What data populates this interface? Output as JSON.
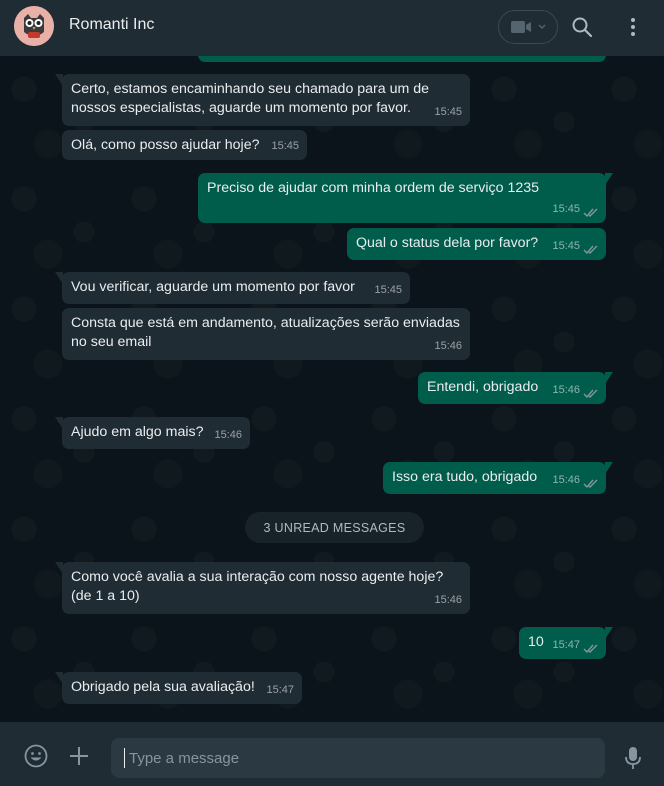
{
  "header": {
    "contact_name": "Romanti Inc",
    "avatar": "owl-logo",
    "icons": [
      "video-call-icon",
      "chevron-down-icon",
      "search-icon",
      "menu-dots-icon"
    ]
  },
  "messages": [
    {
      "dir": "in",
      "text": "Certo, estamos encaminhando seu chamado para um de nossos especialistas, aguarde um momento por favor.",
      "time": "15:45"
    },
    {
      "dir": "in",
      "text": "Olá, como posso ajudar hoje?",
      "time": "15:45"
    },
    {
      "dir": "out",
      "text": "Preciso de ajudar com minha ordem de serviço 1235",
      "time": "15:45",
      "status": "read"
    },
    {
      "dir": "out",
      "text": "Qual o status dela por favor?",
      "time": "15:45",
      "status": "read"
    },
    {
      "dir": "in",
      "text": "Vou verificar, aguarde um momento por favor",
      "time": "15:45"
    },
    {
      "dir": "in",
      "text": "Consta que está em andamento, atualizações serão enviadas no seu email",
      "time": "15:46"
    },
    {
      "dir": "out",
      "text": "Entendi, obrigado",
      "time": "15:46",
      "status": "read"
    },
    {
      "dir": "in",
      "text": "Ajudo em algo mais?",
      "time": "15:46"
    },
    {
      "dir": "out",
      "text": "Isso era tudo, obrigado",
      "time": "15:46",
      "status": "read"
    },
    {
      "dir": "in",
      "text": "Como você avalia a sua interação com nosso agente hoje? (de 1 a 10)",
      "time": "15:46"
    },
    {
      "dir": "out",
      "text": "10",
      "time": "15:47",
      "status": "read"
    },
    {
      "dir": "in",
      "text": "Obrigado pela sua avaliação!",
      "time": "15:47"
    }
  ],
  "unread_divider": "3 UNREAD MESSAGES",
  "composer": {
    "placeholder": "Type a message",
    "icons": [
      "emoji-icon",
      "attach-plus-icon",
      "microphone-icon"
    ]
  },
  "colors": {
    "incoming_bubble": "#202c33",
    "outgoing_bubble": "#005c4b",
    "background": "#0b141a",
    "read_ticks": "#8696a0"
  }
}
